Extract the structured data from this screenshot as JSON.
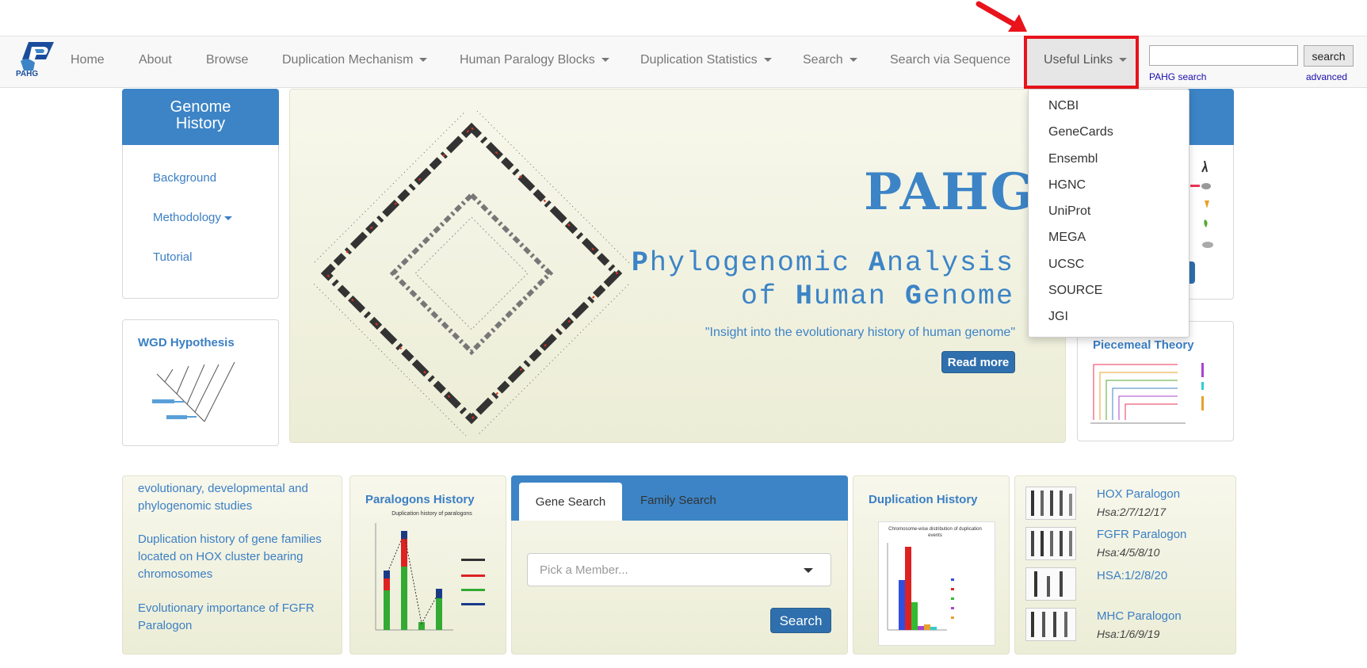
{
  "navbar": {
    "logo_text": "PAHG",
    "items": [
      {
        "label": "Home",
        "dropdown": false
      },
      {
        "label": "About",
        "dropdown": false
      },
      {
        "label": "Browse",
        "dropdown": false
      },
      {
        "label": "Duplication Mechanism",
        "dropdown": true
      },
      {
        "label": "Human Paralogy Blocks",
        "dropdown": true
      },
      {
        "label": "Duplication Statistics",
        "dropdown": true
      },
      {
        "label": "Search",
        "dropdown": true
      },
      {
        "label": "Search via Sequence",
        "dropdown": false
      },
      {
        "label": "Useful Links",
        "dropdown": true
      }
    ],
    "search_button": "search",
    "search_value": "",
    "pahg_search_link": "PAHG search",
    "advanced_link": "advanced"
  },
  "useful_links_menu": [
    "NCBI",
    "GeneCards",
    "Ensembl",
    "HGNC",
    "UniProt",
    "MEGA",
    "UCSC",
    "SOURCE",
    "JGI"
  ],
  "sidebar": {
    "title": "Genome History",
    "links": [
      "Background",
      "Methodology",
      "Tutorial"
    ]
  },
  "wgd": {
    "title": "WGD Hypothesis"
  },
  "piecemeal": {
    "title": "Piecemeal Theory"
  },
  "hero": {
    "title": "PAHG",
    "subtitle_line1_parts": [
      "P",
      "hylogenomic ",
      "A",
      "nalysis"
    ],
    "subtitle_line2_parts": [
      "of ",
      "H",
      "uman ",
      "G",
      "enome"
    ],
    "tagline": "\"Insight into the evolutionary history of human genome\"",
    "read_more": "Read more"
  },
  "news": {
    "items": [
      "evolutionary, developmental and phylogenomic studies",
      "Duplication history of gene families located on HOX cluster bearing chromosomes",
      "Evolutionary importance of FGFR Paralogon"
    ]
  },
  "paralogons_history": {
    "title": "Paralogons History",
    "chart_title": "Duplication history of paralogons"
  },
  "search_panel": {
    "tabs": [
      "Gene Search",
      "Family Search"
    ],
    "placeholder": "Pick a Member...",
    "button": "Search"
  },
  "duplication_history": {
    "title": "Duplication History",
    "chart_title": "Chromosome-wise distribution of duplication events"
  },
  "paralogons": [
    {
      "title": "HOX Paralogon",
      "sub": "Hsa:2/7/12/17"
    },
    {
      "title": "FGFR Paralogon",
      "sub": "Hsa:4/5/8/10"
    },
    {
      "title": "HSA:1/2/8/20",
      "sub": ""
    },
    {
      "title": "MHC Paralogon",
      "sub": "Hsa:1/6/9/19"
    }
  ],
  "colors": {
    "accent": "#3c84c6",
    "highlight": "#e8131b",
    "button": "#2f6fad"
  }
}
